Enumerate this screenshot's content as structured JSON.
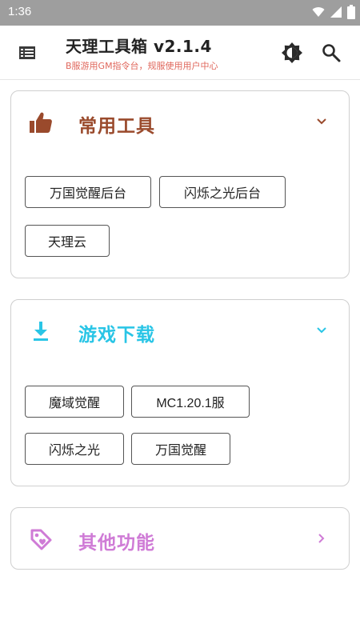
{
  "status_bar": {
    "time": "1:36"
  },
  "app_bar": {
    "title": "天理工具箱 v2.1.4",
    "subtitle": "B服游用GM指令台，规服使用用户中心"
  },
  "sections": [
    {
      "title": "常用工具",
      "icon": "thumbs-up-icon",
      "color": "#9a4a2c",
      "chips": [
        "万国觉醒后台",
        "闪烁之光后台",
        "天理云"
      ]
    },
    {
      "title": "游戏下载",
      "icon": "download-icon",
      "color": "#29c5e6",
      "chips": [
        "魔域觉醒",
        "MC1.20.1服",
        "闪烁之光",
        "万国觉醒"
      ]
    },
    {
      "title": "其他功能",
      "icon": "tag-icon",
      "color": "#cf7bd6",
      "chips": []
    }
  ]
}
